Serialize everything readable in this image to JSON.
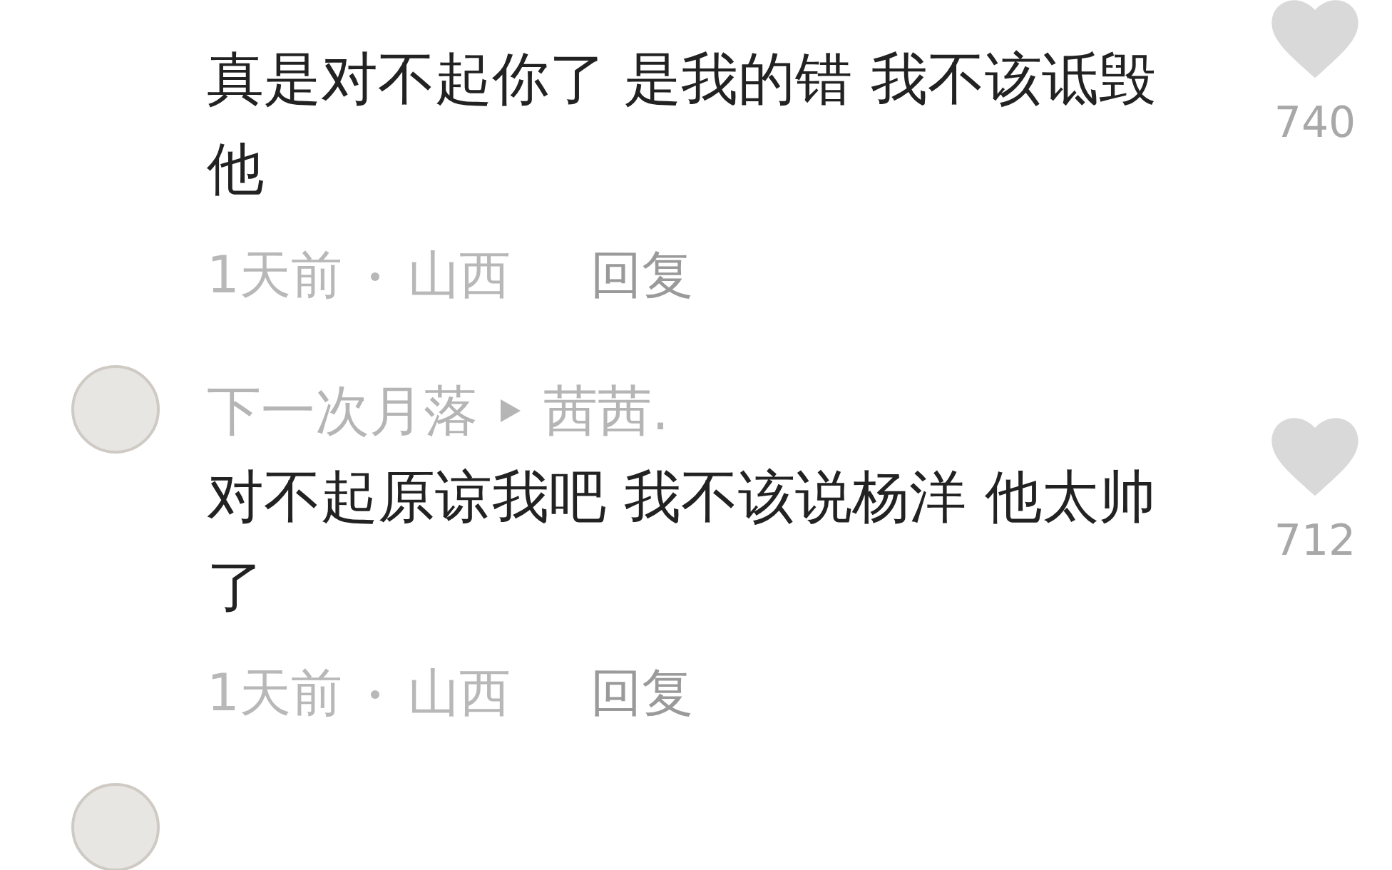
{
  "comments": [
    {
      "avatar": false,
      "text": "真是对不起你了 是我的错 我不该诋毁他",
      "time": "1天前",
      "location": "山西",
      "reply": "回复",
      "likes": "740"
    },
    {
      "avatar": true,
      "user": "下一次月落",
      "reply_to": "茜茜.",
      "text": "对不起原谅我吧 我不该说杨洋 他太帅了",
      "time": "1天前",
      "location": "山西",
      "reply": "回复",
      "likes": "712"
    },
    {
      "avatar": true
    }
  ]
}
